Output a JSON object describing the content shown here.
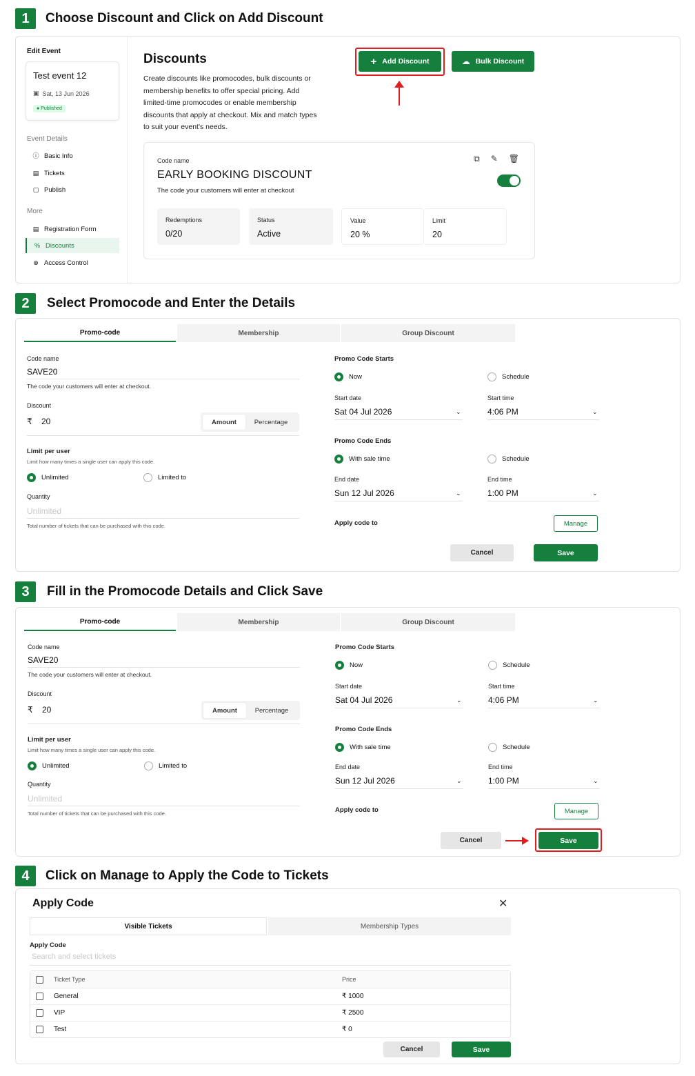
{
  "colors": {
    "brand": "#15803d",
    "highlight": "#e11d1d"
  },
  "steps": [
    {
      "num": "1",
      "title": "Choose Discount and Click on Add Discount"
    },
    {
      "num": "2",
      "title": "Select Promocode and Enter the Details"
    },
    {
      "num": "3",
      "title": "Fill in the Promocode Details and Click Save"
    },
    {
      "num": "4",
      "title": "Click on Manage to Apply the Code to Tickets"
    }
  ],
  "sidebar": {
    "title": "Edit Event",
    "event": {
      "name": "Test event 12",
      "date": "Sat, 13 Jun 2026",
      "status": "Published"
    },
    "section1": "Event Details",
    "items1": [
      {
        "label": "Basic Info",
        "icon": "info-icon"
      },
      {
        "label": "Tickets",
        "icon": "ticket-icon"
      },
      {
        "label": "Publish",
        "icon": "publish-icon"
      }
    ],
    "section2": "More",
    "items2": [
      {
        "label": "Registration Form",
        "icon": "form-icon"
      },
      {
        "label": "Discounts",
        "icon": "percent-icon"
      },
      {
        "label": "Access Control",
        "icon": "access-icon"
      }
    ]
  },
  "discounts": {
    "title": "Discounts",
    "description": "Create discounts like promocodes, bulk discounts or membership benefits to offer special pricing. Add limited-time promocodes or enable membership discounts that apply at checkout. Mix and match types to suit your event's needs.",
    "add_label": "Add Discount",
    "bulk_label": "Bulk Discount",
    "card": {
      "code_label": "Code name",
      "code": "EARLY BOOKING DISCOUNT",
      "sub": "The code your customers will enter at checkout",
      "stats": [
        {
          "label": "Redemptions",
          "value": "0/20"
        },
        {
          "label": "Status",
          "value": "Active"
        },
        {
          "label": "Value",
          "value": "20 %"
        },
        {
          "label": "Limit",
          "value": "20"
        }
      ]
    }
  },
  "form": {
    "tabs": [
      "Promo-code",
      "Membership",
      "Group Discount"
    ],
    "code_label": "Code name",
    "code_value": "SAVE20",
    "code_sub": "The code your customers will enter at checkout.",
    "discount_label": "Discount",
    "currency": "₹",
    "discount_value": "20",
    "seg": [
      "Amount",
      "Percentage"
    ],
    "limit_label": "Limit per user",
    "limit_sub": "Limit how many times a single user can apply this code.",
    "limit_opts": [
      "Unlimited",
      "Limited to"
    ],
    "qty_label": "Quantity",
    "qty_placeholder": "Unlimited",
    "qty_sub": "Total number of tickets that can be purchased with this code.",
    "starts_label": "Promo Code Starts",
    "starts_opts": [
      "Now",
      "Schedule"
    ],
    "start_date_label": "Start date",
    "start_date": "Sat 04 Jul 2026",
    "start_time_label": "Start time",
    "start_time": "4:06 PM",
    "ends_label": "Promo Code Ends",
    "ends_opts": [
      "With sale time",
      "Schedule"
    ],
    "end_date_label": "End date",
    "end_date": "Sun 12 Jul 2026",
    "end_time_label": "End time",
    "end_time": "1:00 PM",
    "apply_label": "Apply code to",
    "manage_label": "Manage",
    "cancel_label": "Cancel",
    "save_label": "Save"
  },
  "apply": {
    "title": "Apply Code",
    "tabs": [
      "Visible Tickets",
      "Membership Types"
    ],
    "label": "Apply Code",
    "search_placeholder": "Search and select tickets",
    "headers": [
      "Ticket Type",
      "Price"
    ],
    "rows": [
      {
        "type": "General",
        "price": "₹ 1000"
      },
      {
        "type": "VIP",
        "price": "₹ 2500"
      },
      {
        "type": "Test",
        "price": "₹ 0"
      }
    ],
    "cancel_label": "Cancel",
    "save_label": "Save"
  }
}
